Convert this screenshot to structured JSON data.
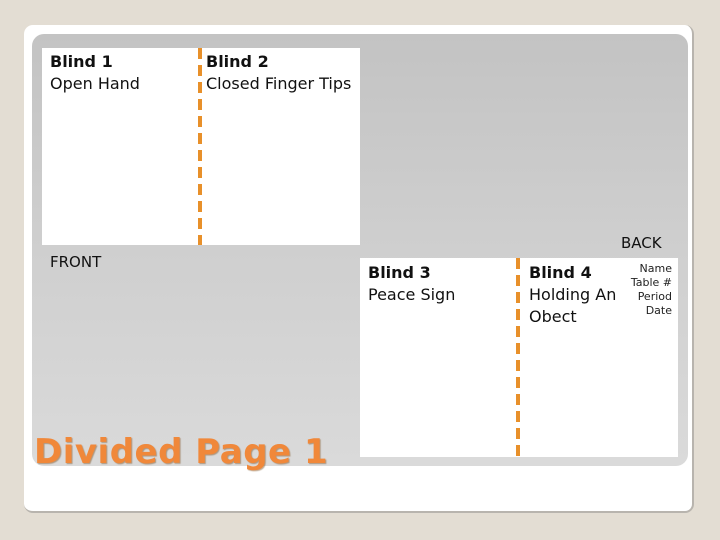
{
  "slide": {
    "title": "Divided Page 1",
    "front_label": "FRONT",
    "back_label": "BACK",
    "accent_color": "#f0883a",
    "divider_color": "#e8902a"
  },
  "front": {
    "blinds": [
      {
        "title": "Blind 1",
        "desc": "Open Hand"
      },
      {
        "title": "Blind 2",
        "desc": "Closed Finger Tips"
      }
    ]
  },
  "back": {
    "blinds": [
      {
        "title": "Blind 3",
        "desc": "Peace Sign"
      },
      {
        "title": "Blind 4",
        "desc": "Holding An Obect"
      }
    ],
    "meta": [
      "Name",
      "Table #",
      "Period",
      "Date"
    ]
  }
}
